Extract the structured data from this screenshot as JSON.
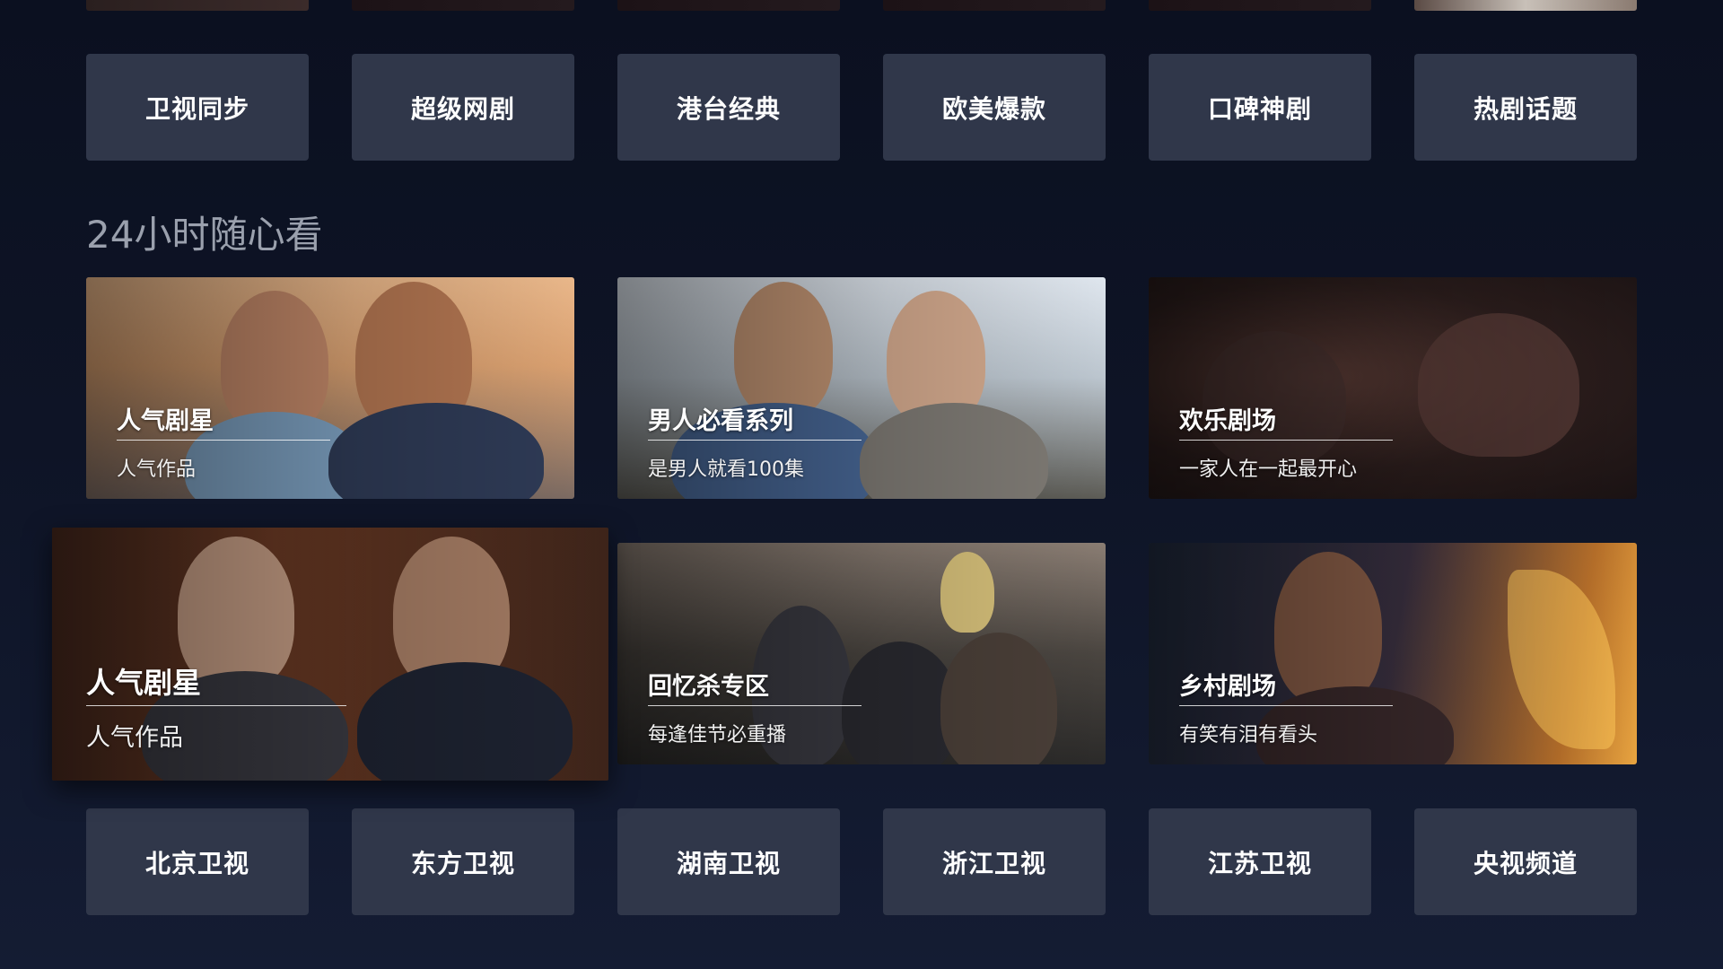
{
  "top_row_partial": [
    "",
    "",
    "",
    "",
    "",
    ""
  ],
  "category_row_1": [
    "卫视同步",
    "超级网剧",
    "港台经典",
    "欧美爆款",
    "口碑神剧",
    "热剧话题"
  ],
  "section": {
    "title": "24小时随心看"
  },
  "cards": [
    {
      "title": "人气剧星",
      "subtitle": "人气作品"
    },
    {
      "title": "男人必看系列",
      "subtitle": "是男人就看100集"
    },
    {
      "title": "欢乐剧场",
      "subtitle": "一家人在一起最开心"
    },
    {
      "title": "人气剧星",
      "subtitle": "人气作品"
    },
    {
      "title": "回忆杀专区",
      "subtitle": "每逢佳节必重播"
    },
    {
      "title": "乡村剧场",
      "subtitle": "有笑有泪有看头"
    }
  ],
  "category_row_2": [
    "北京卫视",
    "东方卫视",
    "湖南卫视",
    "浙江卫视",
    "江苏卫视",
    "央视频道"
  ],
  "colors": {
    "background": "#0e1426",
    "button": "#30374a",
    "section_title": "#9aa0ad"
  }
}
